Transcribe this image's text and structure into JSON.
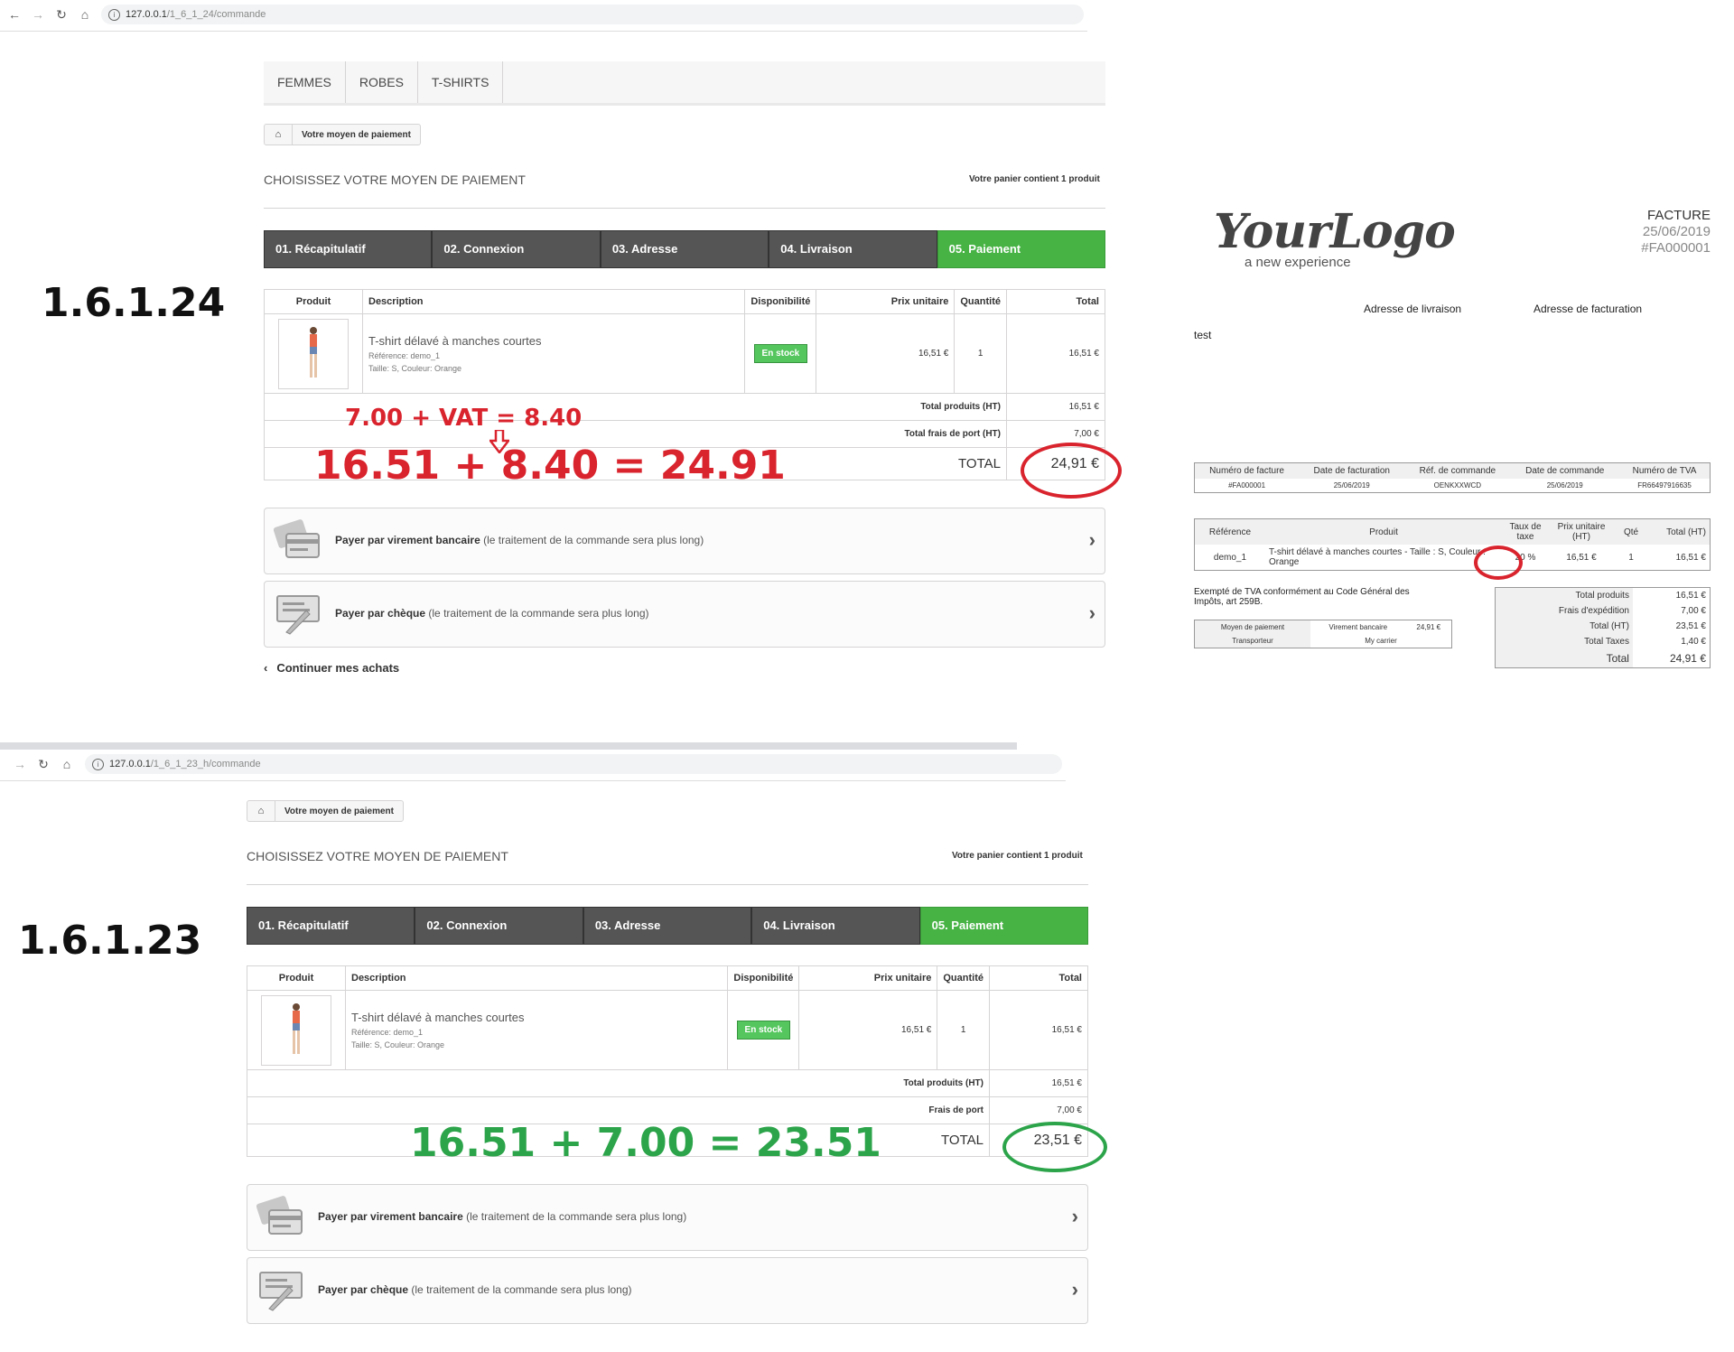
{
  "top": {
    "browser": {
      "host": "127.0.0.1",
      "path": "/1_6_1_24/commande"
    },
    "menu": [
      "FEMMES",
      "ROBES",
      "T-SHIRTS"
    ],
    "version": "1.6.1.24",
    "breadcrumb": "Votre moyen de paiement",
    "heading": "CHOISISSEZ VOTRE MOYEN DE PAIEMENT",
    "cart_count": "Votre panier contient 1 produit",
    "steps": [
      "01. Récapitulatif",
      "02. Connexion",
      "03. Adresse",
      "04. Livraison",
      "05. Paiement"
    ],
    "table": {
      "headers": [
        "Produit",
        "Description",
        "Disponibilité",
        "Prix unitaire",
        "Quantité",
        "Total"
      ],
      "product_name": "T-shirt délavé à manches courtes",
      "reference": "Référence: demo_1",
      "attributes": "Taille: S, Couleur: Orange",
      "stock": "En stock",
      "unit_price": "16,51 €",
      "quantity": "1",
      "total": "16,51 €",
      "total_products_label": "Total produits (HT)",
      "total_products": "16,51 €",
      "shipping_label": "Total frais de port (HT)",
      "shipping": "7,00 €",
      "grand_total_label": "TOTAL",
      "grand_total": "24,91 €"
    },
    "annotation_vat": "7.00 + VAT = 8.40",
    "annotation_sum": "16.51 + 8.40 = 24.91",
    "pay_bank_bold": "Payer par virement bancaire",
    "pay_bank_rest": " (le traitement de la commande sera plus long)",
    "pay_cheque_bold": "Payer par chèque",
    "pay_cheque_rest": " (le traitement de la commande sera plus long)",
    "continue": "Continuer mes achats"
  },
  "invoice": {
    "logo": "YourLogo",
    "logo_sub": "a new experience",
    "title": "FACTURE",
    "date": "25/06/2019",
    "number": "#FA000001",
    "delivery_address": "Adresse de livraison",
    "billing_address": "Adresse de facturation",
    "customer": "test",
    "info_headers": [
      "Numéro de facture",
      "Date de facturation",
      "Réf. de commande",
      "Date de commande",
      "Numéro de TVA"
    ],
    "info_values": [
      "#FA000001",
      "25/06/2019",
      "OENKXXWCD",
      "25/06/2019",
      "FR66497916635"
    ],
    "line_headers": [
      "Référence",
      "Produit",
      "Taux de taxe",
      "Prix unitaire (HT)",
      "Qté",
      "Total (HT)"
    ],
    "line": {
      "ref": "demo_1",
      "product": "T-shirt délavé à manches courtes - Taille : S, Couleur : Orange",
      "tax": "20 %",
      "unit": "16,51 €",
      "qty": "1",
      "total": "16,51 €"
    },
    "exempt": "Exempté de TVA conformément au Code Général des Impôts, art 259B.",
    "payment_label": "Moyen de paiement",
    "payment_method": "Virement bancaire",
    "payment_amount": "24,91 €",
    "carrier_label": "Transporteur",
    "carrier": "My carrier",
    "totals": [
      {
        "label": "Total produits",
        "value": "16,51 €"
      },
      {
        "label": "Frais d'expédition",
        "value": "7,00 €"
      },
      {
        "label": "Total (HT)",
        "value": "23,51 €"
      },
      {
        "label": "Total Taxes",
        "value": "1,40 €"
      },
      {
        "label": "Total",
        "value": "24,91 €"
      }
    ]
  },
  "bottom": {
    "browser": {
      "host": "127.0.0.1",
      "path": "/1_6_1_23_h/commande"
    },
    "version": "1.6.1.23",
    "breadcrumb": "Votre moyen de paiement",
    "heading": "CHOISISSEZ VOTRE MOYEN DE PAIEMENT",
    "cart_count": "Votre panier contient 1 produit",
    "steps": [
      "01. Récapitulatif",
      "02. Connexion",
      "03. Adresse",
      "04. Livraison",
      "05. Paiement"
    ],
    "table": {
      "headers": [
        "Produit",
        "Description",
        "Disponibilité",
        "Prix unitaire",
        "Quantité",
        "Total"
      ],
      "product_name": "T-shirt délavé à manches courtes",
      "reference": "Référence: demo_1",
      "attributes": "Taille: S, Couleur: Orange",
      "stock": "En stock",
      "unit_price": "16,51 €",
      "quantity": "1",
      "total": "16,51 €",
      "total_products_label": "Total produits (HT)",
      "total_products": "16,51 €",
      "shipping_label": "Frais de port",
      "shipping": "7,00 €",
      "grand_total_label": "TOTAL",
      "grand_total": "23,51 €"
    },
    "annotation_sum": "16.51 + 7.00 = 23.51",
    "pay_bank_bold": "Payer par virement bancaire",
    "pay_bank_rest": " (le traitement de la commande sera plus long)",
    "pay_cheque_bold": "Payer par chèque",
    "pay_cheque_rest": " (le traitement de la commande sera plus long)"
  }
}
